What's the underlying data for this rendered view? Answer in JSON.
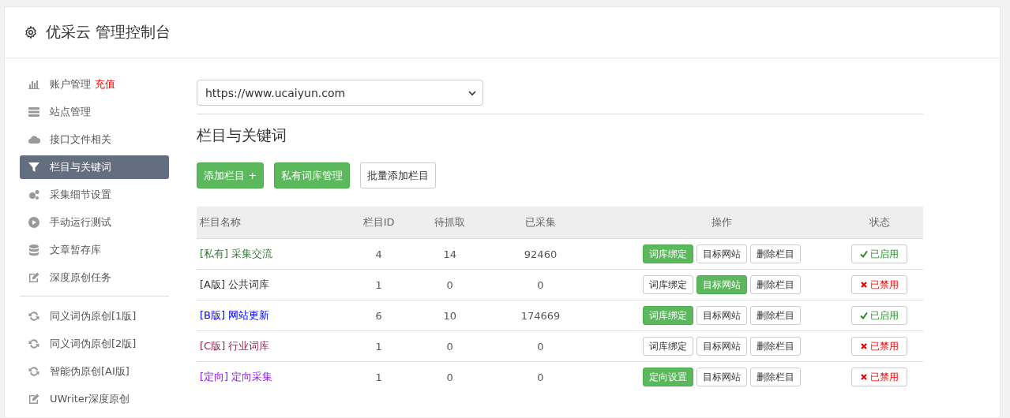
{
  "header": {
    "title": "优采云 管理控制台"
  },
  "sidebar": {
    "groups": [
      [
        {
          "label": "账户管理",
          "badge": "充值",
          "selected": false
        },
        {
          "label": "站点管理",
          "selected": false
        },
        {
          "label": "接口文件相关",
          "selected": false
        },
        {
          "label": "栏目与关键词",
          "selected": true
        },
        {
          "label": "采集细节设置",
          "selected": false
        },
        {
          "label": "手动运行测试",
          "selected": false
        },
        {
          "label": "文章暂存库",
          "selected": false
        },
        {
          "label": "深度原创任务",
          "selected": false
        }
      ],
      [
        {
          "label": "同义词伪原创[1版]",
          "selected": false
        },
        {
          "label": "同义词伪原创[2版]",
          "selected": false
        },
        {
          "label": "智能伪原创[AI版]",
          "selected": false
        },
        {
          "label": "UWriter深度原创",
          "selected": false
        }
      ]
    ]
  },
  "site_select": {
    "value": "https://www.ucaiyun.com"
  },
  "section_title": "栏目与关键词",
  "toolbar": [
    {
      "label": "添加栏目 +",
      "primary": true
    },
    {
      "label": "私有词库管理",
      "primary": true
    },
    {
      "label": "批量添加栏目",
      "primary": false
    }
  ],
  "table": {
    "columns": [
      "栏目名称",
      "栏目ID",
      "待抓取",
      "已采集",
      "操作",
      "状态"
    ],
    "rows": [
      {
        "tag": "[私有]",
        "name": "采集交流",
        "color": "#3c763d",
        "id": "4",
        "pending": "14",
        "collected": "92460",
        "actions": [
          {
            "label": "词库绑定",
            "primary": true
          },
          {
            "label": "目标网站",
            "primary": false
          },
          {
            "label": "删除栏目",
            "primary": false
          }
        ],
        "status": {
          "label": "已启用",
          "enabled": true
        }
      },
      {
        "tag": "[A版]",
        "name": "公共词库",
        "color": "#333333",
        "id": "1",
        "pending": "0",
        "collected": "0",
        "actions": [
          {
            "label": "词库绑定",
            "primary": false
          },
          {
            "label": "目标网站",
            "primary": true
          },
          {
            "label": "删除栏目",
            "primary": false
          }
        ],
        "status": {
          "label": "已禁用",
          "enabled": false
        }
      },
      {
        "tag": "[B版]",
        "name": "网站更新",
        "color": "#0000ee",
        "id": "6",
        "pending": "10",
        "collected": "174669",
        "actions": [
          {
            "label": "词库绑定",
            "primary": true
          },
          {
            "label": "目标网站",
            "primary": false
          },
          {
            "label": "删除栏目",
            "primary": false
          }
        ],
        "status": {
          "label": "已启用",
          "enabled": true
        }
      },
      {
        "tag": "[C版]",
        "name": "行业词库",
        "color": "#a3204a",
        "id": "1",
        "pending": "0",
        "collected": "0",
        "actions": [
          {
            "label": "词库绑定",
            "primary": false
          },
          {
            "label": "目标网站",
            "primary": false
          },
          {
            "label": "删除栏目",
            "primary": false
          }
        ],
        "status": {
          "label": "已禁用",
          "enabled": false
        }
      },
      {
        "tag": "[定向]",
        "name": "定向采集",
        "color": "#8a1ee6",
        "id": "1",
        "pending": "0",
        "collected": "0",
        "actions": [
          {
            "label": "定向设置",
            "primary": true
          },
          {
            "label": "目标网站",
            "primary": false
          },
          {
            "label": "删除栏目",
            "primary": false
          }
        ],
        "status": {
          "label": "已禁用",
          "enabled": false
        }
      }
    ]
  }
}
